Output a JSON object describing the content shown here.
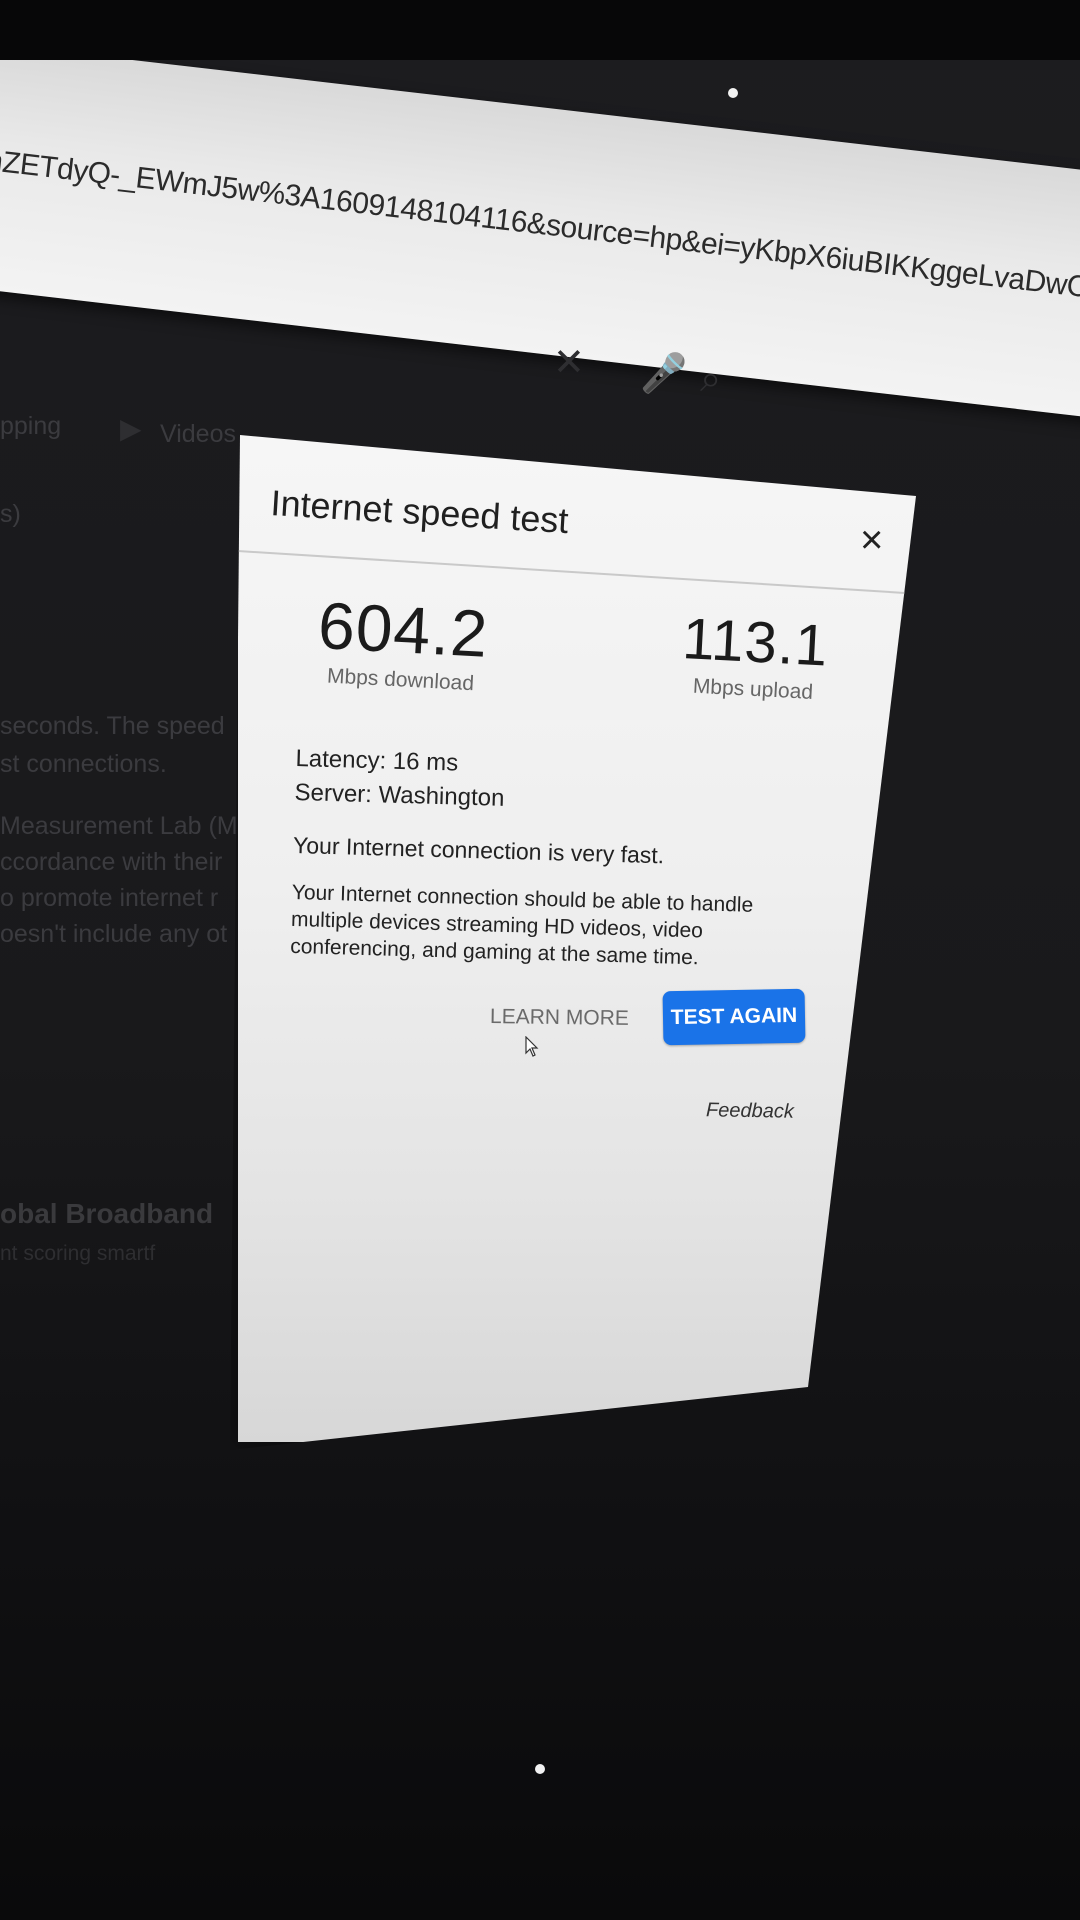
{
  "browser": {
    "url_fragment": "nZETdyQ-_EWmJ5w%3A1609148104116&source=hp&ei=yKbpX6iuBIKKggeLvaDwCA&q=internet+"
  },
  "background": {
    "tabs": [
      {
        "label": "pping"
      },
      {
        "label": "Videos",
        "icon": "video-play-icon"
      }
    ],
    "search_icons": [
      "clear-x-icon",
      "microphone-icon",
      "search-magnifier-icon"
    ],
    "result_fragments": [
      "s)",
      "seconds. The speed",
      "st connections.",
      "Measurement Lab (M",
      "ccordance with their",
      "o promote internet r",
      "oesn't include any ot"
    ],
    "heading_fragment": "obal Broadband",
    "subheading_fragment": "nt scoring smartf"
  },
  "dialog": {
    "title": "Internet speed test",
    "close_label": "×",
    "download": {
      "value": "604.2",
      "unit": "Mbps download"
    },
    "upload": {
      "value": "113.1",
      "unit": "Mbps upload"
    },
    "latency": "Latency: 16 ms",
    "server": "Server: Washington",
    "verdict": "Your Internet connection is very fast.",
    "advice": "Your Internet connection should be able to handle multiple devices streaming HD videos, video conferencing, and gaming at the same time.",
    "learn_more_label": "LEARN MORE",
    "test_again_label": "TEST AGAIN",
    "feedback_label": "Feedback",
    "accent_color": "#1a73e8"
  }
}
